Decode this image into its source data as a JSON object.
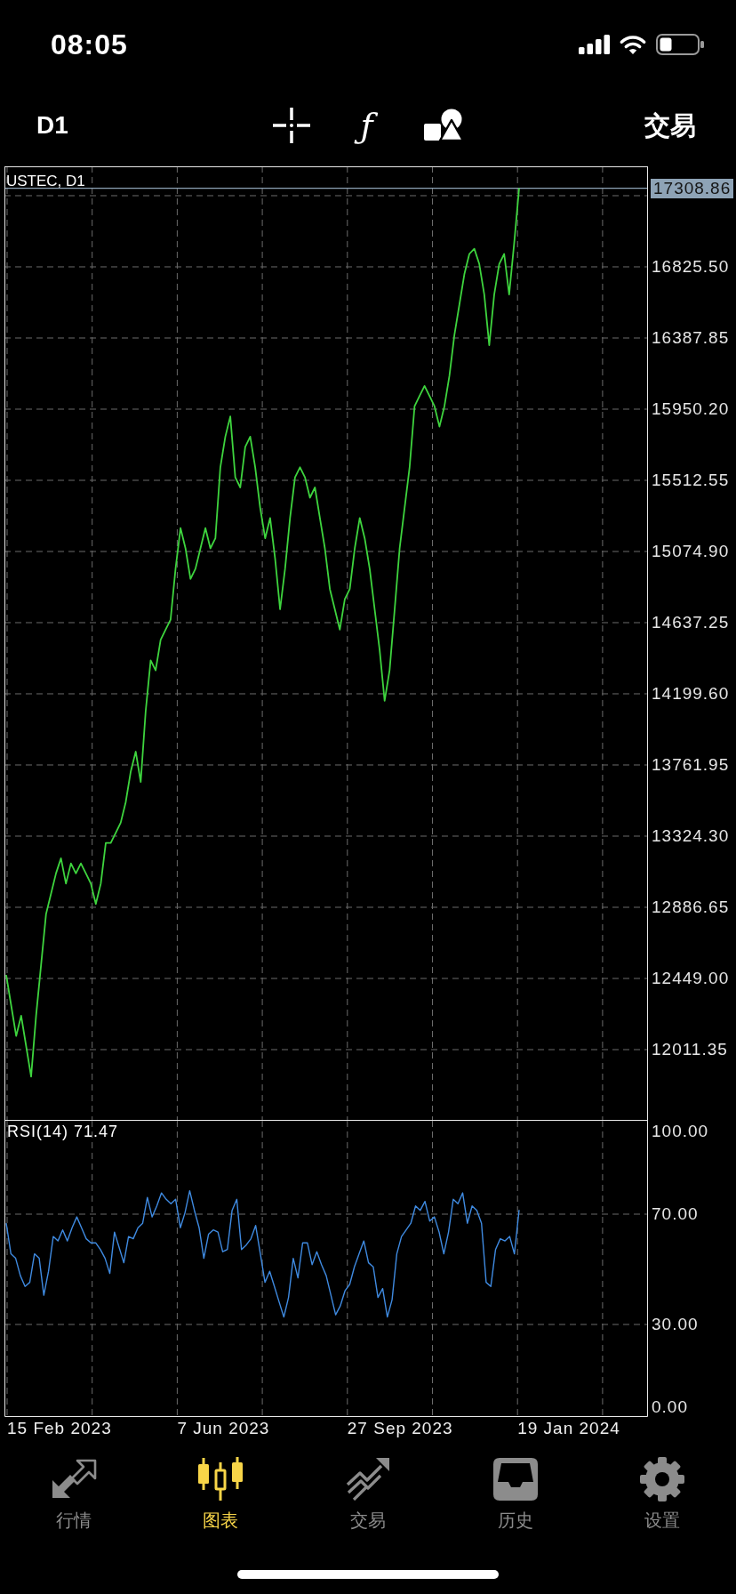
{
  "status_bar": {
    "time": "08:05"
  },
  "toolbar": {
    "timeframe": "D1",
    "function_symbol": "ƒ",
    "trade": "交易"
  },
  "chart": {
    "price_pane": {
      "chart_data": {
        "type": "line",
        "title": "USTEC, D1",
        "grid": true,
        "ylim": [
          11573.65,
          17443.65
        ],
        "yticks": [
          {
            "value": 16825.5,
            "label": "16825.50"
          },
          {
            "value": 16387.85,
            "label": "16387.85"
          },
          {
            "value": 15950.2,
            "label": "15950.20"
          },
          {
            "value": 15512.55,
            "label": "15512.55"
          },
          {
            "value": 15074.9,
            "label": "15074.90"
          },
          {
            "value": 14637.25,
            "label": "14637.25"
          },
          {
            "value": 14199.6,
            "label": "14199.60"
          },
          {
            "value": 13761.95,
            "label": "13761.95"
          },
          {
            "value": 13324.3,
            "label": "13324.30"
          },
          {
            "value": 12886.65,
            "label": "12886.65"
          },
          {
            "value": 12449,
            "label": "12449.00"
          },
          {
            "value": 12011.35,
            "label": "12011.35"
          }
        ],
        "series": [
          {
            "color": "#3ed43e",
            "values": [
              12470,
              12282,
              12095,
              12220,
              12033,
              11845,
              12220,
              12532,
              12845,
              12970,
              13095,
              13188,
              13032,
              13157,
              13095,
              13157,
              13095,
              13032,
              12907,
              13032,
              13282,
              13282,
              13344,
              13407,
              13532,
              13719,
              13844,
              13657,
              14094,
              14406,
              14344,
              14531,
              14594,
              14656,
              14969,
              15219,
              15094,
              14906,
              14969,
              15094,
              15219,
              15094,
              15156,
              15593,
              15781,
              15906,
              15531,
              15469,
              15719,
              15781,
              15593,
              15344,
              15156,
              15281,
              15031,
              14719,
              14969,
              15281,
              15531,
              15593,
              15531,
              15406,
              15469,
              15281,
              15094,
              14844,
              14719,
              14594,
              14781,
              14844,
              15094,
              15281,
              15156,
              14969,
              14719,
              14469,
              14157,
              14344,
              14719,
              15094,
              15344,
              15593,
              15968,
              16031,
              16093,
              16031,
              15968,
              15843,
              15968,
              16156,
              16406,
              16593,
              16780,
              16905,
              16937,
              16843,
              16655,
              16343,
              16655,
              16843,
              16905,
              16655,
              16968,
              17309
            ]
          }
        ],
        "ref_lines": [
          {
            "axis": "y",
            "value": 17308.86,
            "label": "17308.86",
            "color": "#8ea3b6"
          }
        ]
      }
    },
    "rsi_pane": {
      "chart_data": {
        "type": "line",
        "title": "RSI(14) 71.47",
        "grid": true,
        "ylim": [
          -3.55,
          103.87
        ],
        "yticks": [
          {
            "value": 100,
            "label": "100.00"
          },
          {
            "value": 70,
            "label": "70.00"
          },
          {
            "value": 30,
            "label": "30.00"
          },
          {
            "value": 0,
            "label": "0.00"
          }
        ],
        "series": [
          {
            "color": "#3f8ae0",
            "values": [
              66.7,
              55.6,
              54,
              47.7,
              43.8,
              45.3,
              55.6,
              54,
              40.6,
              49.3,
              61.9,
              60.3,
              64.3,
              60.3,
              65.1,
              69,
              65.1,
              61.1,
              59.6,
              59.6,
              57.2,
              54,
              48.5,
              63.5,
              58,
              52.4,
              61.9,
              61.1,
              65.1,
              66.7,
              76.1,
              69,
              73,
              77.7,
              75.4,
              73.8,
              75.4,
              65.1,
              70.6,
              78.5,
              71.4,
              65.1,
              54,
              62.7,
              64.3,
              63.5,
              56.4,
              57.2,
              71.4,
              75.4,
              57.2,
              58.8,
              61.1,
              65.9,
              55.6,
              45.3,
              49.3,
              43.8,
              38.2,
              32.7,
              39.8,
              54,
              46.9,
              59.6,
              59.6,
              51.7,
              56.4,
              51.7,
              47.7,
              40.6,
              33.5,
              36.7,
              42.2,
              44.5,
              50.9,
              55.6,
              60.3,
              52.4,
              50.9,
              39.8,
              43,
              32.7,
              39,
              55.6,
              61.9,
              64.3,
              66.7,
              73,
              71.4,
              74.6,
              67.5,
              69,
              63.5,
              55.6,
              63.5,
              75.4,
              73.8,
              77.7,
              66.7,
              73,
              71.4,
              66.7,
              45.3,
              43.8,
              57.2,
              61.1,
              60.3,
              61.9,
              55.6,
              71.5
            ]
          }
        ]
      }
    },
    "time_axis": [
      "15 Feb 2023",
      "7 Jun 2023",
      "27 Sep 2023",
      "19 Jan 2024"
    ]
  },
  "tab_bar": {
    "tabs": [
      {
        "label": "行情",
        "kind": "quotes",
        "selected": false
      },
      {
        "label": "图表",
        "kind": "chart",
        "selected": true
      },
      {
        "label": "交易",
        "kind": "trade",
        "selected": false
      },
      {
        "label": "历史",
        "kind": "history",
        "selected": false
      },
      {
        "label": "设置",
        "kind": "settings",
        "selected": false
      }
    ]
  }
}
